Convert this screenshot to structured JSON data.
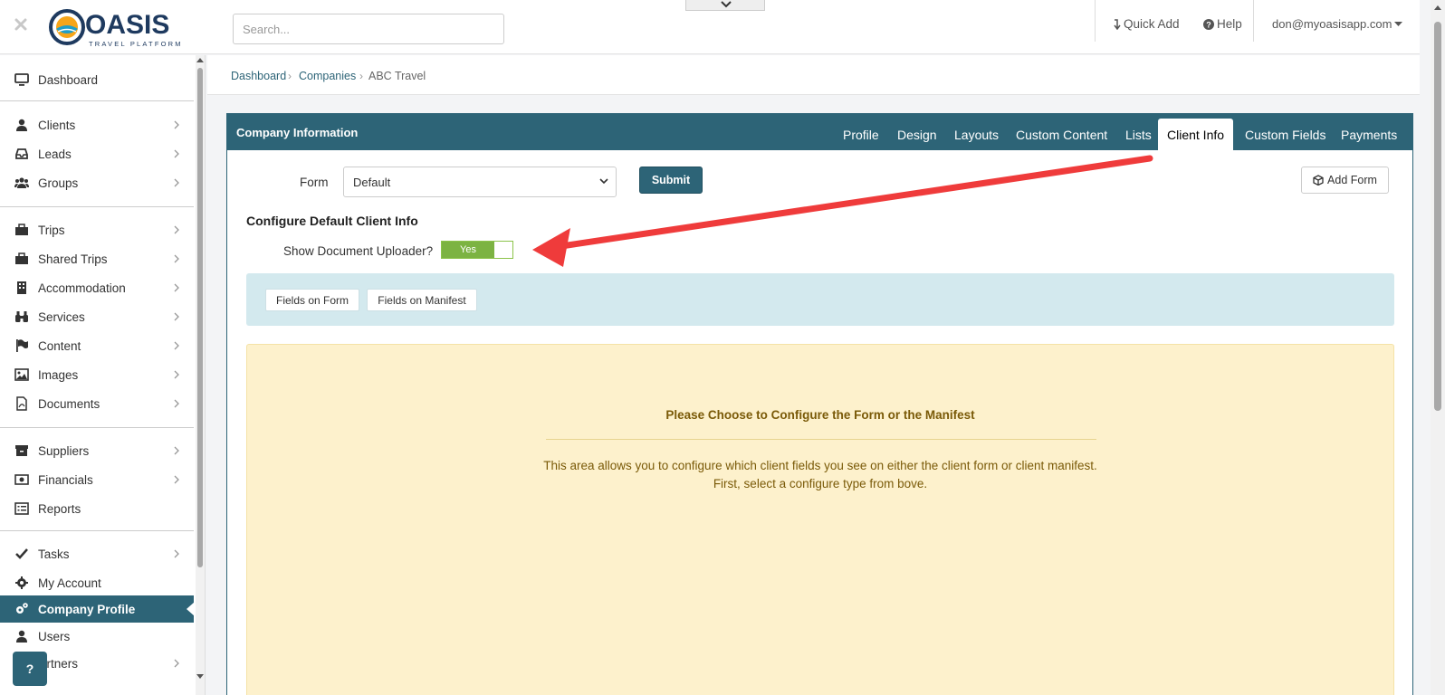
{
  "header": {
    "logo": {
      "name": "OASIS",
      "tagline": "TRAVEL PLATFORM"
    },
    "search": {
      "placeholder": "Search..."
    },
    "quick_add": "Quick Add",
    "help": "Help",
    "user": "don@myoasisapp.com"
  },
  "sidebar": {
    "items": [
      {
        "label": "Dashboard",
        "icon": "monitor-icon",
        "chevron": false
      },
      {
        "label": "Clients",
        "icon": "user-icon",
        "chevron": true
      },
      {
        "label": "Leads",
        "icon": "inbox-icon",
        "chevron": true
      },
      {
        "label": "Groups",
        "icon": "users-icon",
        "chevron": true
      },
      {
        "label": "Trips",
        "icon": "briefcase-icon",
        "chevron": true
      },
      {
        "label": "Shared Trips",
        "icon": "briefcase-icon",
        "chevron": true
      },
      {
        "label": "Accommodation",
        "icon": "building-icon",
        "chevron": true
      },
      {
        "label": "Services",
        "icon": "binoculars-icon",
        "chevron": true
      },
      {
        "label": "Content",
        "icon": "flag-icon",
        "chevron": true
      },
      {
        "label": "Images",
        "icon": "image-icon",
        "chevron": true
      },
      {
        "label": "Documents",
        "icon": "pdf-file-icon",
        "chevron": true
      },
      {
        "label": "Suppliers",
        "icon": "archive-icon",
        "chevron": true
      },
      {
        "label": "Financials",
        "icon": "money-icon",
        "chevron": true
      },
      {
        "label": "Reports",
        "icon": "list-alt-icon",
        "chevron": false
      },
      {
        "label": "Tasks",
        "icon": "check-icon",
        "chevron": true
      },
      {
        "label": "My Account",
        "icon": "gear-icon",
        "chevron": false
      },
      {
        "label": "Company Profile",
        "icon": "gears-icon",
        "chevron": false,
        "active": true
      },
      {
        "label": "Users",
        "icon": "user-icon",
        "chevron": false
      },
      {
        "label": "artners",
        "icon": "handshake-icon",
        "chevron": true
      }
    ],
    "help_button": "?"
  },
  "breadcrumb": [
    "Dashboard",
    "Companies",
    "ABC Travel"
  ],
  "panel": {
    "title": "Company Information",
    "tabs": [
      "Profile",
      "Design",
      "Layouts",
      "Custom Content",
      "Lists",
      "Client Info",
      "Custom Fields",
      "Payments"
    ],
    "active_tab": "Client Info",
    "form_label": "Form",
    "form_value": "Default",
    "submit_label": "Submit",
    "add_form_label": "Add Form",
    "section_title": "Configure Default Client Info",
    "toggle_label": "Show Document Uploader?",
    "toggle_value": "Yes",
    "config_buttons": [
      "Fields on Form",
      "Fields on Manifest"
    ],
    "notice": {
      "title": "Please Choose to Configure the Form or the Manifest",
      "line1": "This area allows you to configure which client fields you see on either the client form or client manifest.",
      "line2": "First, select a configure type from bove."
    }
  },
  "colors": {
    "brand": "#2d6477",
    "toggle_on": "#7cb342",
    "notice_bg": "#fdf1cc",
    "notice_text": "#7a5a08",
    "well_bg": "#d3e9ee",
    "annotation_arrow": "#ef3b3b"
  }
}
